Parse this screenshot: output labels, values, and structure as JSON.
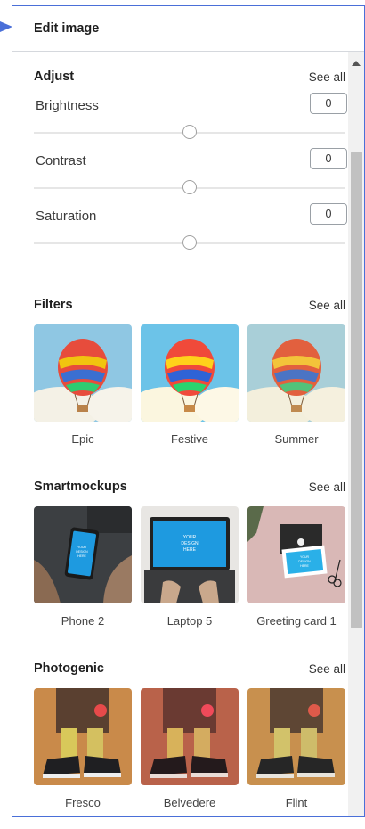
{
  "panel": {
    "title": "Edit image"
  },
  "adjust": {
    "title": "Adjust",
    "see_all": "See all",
    "controls": [
      {
        "label": "Brightness",
        "value": "0",
        "level": 0.5
      },
      {
        "label": "Contrast",
        "value": "0",
        "level": 0.5
      },
      {
        "label": "Saturation",
        "value": "0",
        "level": 0.5
      }
    ]
  },
  "filters": {
    "title": "Filters",
    "see_all": "See all",
    "items": [
      {
        "label": "Epic"
      },
      {
        "label": "Festive"
      },
      {
        "label": "Summer"
      }
    ]
  },
  "smartmockups": {
    "title": "Smartmockups",
    "see_all": "See all",
    "items": [
      {
        "label": "Phone 2"
      },
      {
        "label": "Laptop 5"
      },
      {
        "label": "Greeting card 1"
      }
    ],
    "mockup_text": [
      "YOUR",
      "DESIGN",
      "HERE"
    ]
  },
  "photogenic": {
    "title": "Photogenic",
    "see_all": "See all",
    "items": [
      {
        "label": "Fresco"
      },
      {
        "label": "Belvedere"
      },
      {
        "label": "Flint"
      }
    ]
  },
  "colors": {
    "panel_border": "#4a6fd8",
    "mockup_screen": "#1e9ae0"
  },
  "icons": [
    "arrow-pointer-icon",
    "scroll-up-arrow-icon"
  ]
}
